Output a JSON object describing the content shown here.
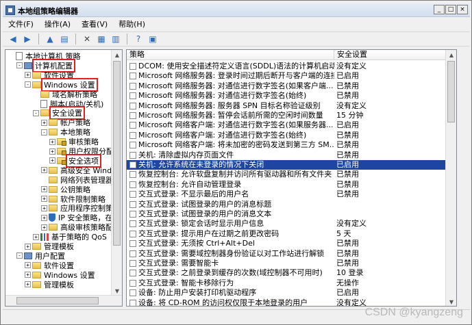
{
  "window": {
    "title": "本地组策略编辑器",
    "buttons": [
      "_",
      "□",
      "×"
    ]
  },
  "menu": [
    "文件(F)",
    "操作(A)",
    "查看(V)",
    "帮助(H)"
  ],
  "tree": [
    {
      "label": "本地计算机 策略",
      "depth": 0,
      "pm": "",
      "icon": "doc-icon",
      "hl": false
    },
    {
      "label": "计算机配置",
      "depth": 1,
      "pm": "-",
      "icon": "computer-icon",
      "hl": true
    },
    {
      "label": "软件设置",
      "depth": 2,
      "pm": "+",
      "icon": "folder-icon",
      "hl": false
    },
    {
      "label": "Windows 设置",
      "depth": 2,
      "pm": "-",
      "icon": "folder-icon",
      "hl": true
    },
    {
      "label": "域名解析策略",
      "depth": 3,
      "pm": "",
      "icon": "folder-icon",
      "hl": false
    },
    {
      "label": "脚本(启动/关机)",
      "depth": 3,
      "pm": "",
      "icon": "doc-icon",
      "hl": false
    },
    {
      "label": "安全设置",
      "depth": 3,
      "pm": "-",
      "icon": "folder-icon",
      "hl": true
    },
    {
      "label": "帐户策略",
      "depth": 4,
      "pm": "+",
      "icon": "folder-icon",
      "hl": false
    },
    {
      "label": "本地策略",
      "depth": 4,
      "pm": "-",
      "icon": "folder-icon",
      "hl": false
    },
    {
      "label": "审核策略",
      "depth": 5,
      "pm": "+",
      "icon": "folder-lock-icon",
      "hl": false
    },
    {
      "label": "用户权限分配",
      "depth": 5,
      "pm": "+",
      "icon": "folder-lock-icon",
      "hl": false
    },
    {
      "label": "安全选项",
      "depth": 5,
      "pm": "+",
      "icon": "folder-lock-icon",
      "hl": true
    },
    {
      "label": "高级安全 Window",
      "depth": 4,
      "pm": "+",
      "icon": "folder-icon",
      "hl": false
    },
    {
      "label": "网络列表管理器策",
      "depth": 4,
      "pm": "",
      "icon": "folder-icon",
      "hl": false
    },
    {
      "label": "公钥策略",
      "depth": 4,
      "pm": "+",
      "icon": "folder-icon",
      "hl": false
    },
    {
      "label": "软件限制策略",
      "depth": 4,
      "pm": "+",
      "icon": "folder-icon",
      "hl": false
    },
    {
      "label": "应用程序控制策略",
      "depth": 4,
      "pm": "+",
      "icon": "folder-icon",
      "hl": false
    },
    {
      "label": "IP 安全策略，在",
      "depth": 4,
      "pm": "+",
      "icon": "shield-icon",
      "hl": false
    },
    {
      "label": "高级审核策略配置",
      "depth": 4,
      "pm": "+",
      "icon": "folder-icon",
      "hl": false
    },
    {
      "label": "基于策略的 QoS",
      "depth": 3,
      "pm": "+",
      "icon": "chart-icon",
      "hl": false
    },
    {
      "label": "管理模板",
      "depth": 2,
      "pm": "+",
      "icon": "folder-icon",
      "hl": false
    },
    {
      "label": "用户配置",
      "depth": 1,
      "pm": "-",
      "icon": "computer-icon",
      "hl": false
    },
    {
      "label": "软件设置",
      "depth": 2,
      "pm": "+",
      "icon": "folder-icon",
      "hl": false
    },
    {
      "label": "Windows 设置",
      "depth": 2,
      "pm": "+",
      "icon": "folder-icon",
      "hl": false
    },
    {
      "label": "管理模板",
      "depth": 2,
      "pm": "+",
      "icon": "folder-icon",
      "hl": false
    }
  ],
  "columns": {
    "policy": "策略",
    "setting": "安全设置"
  },
  "policies": [
    {
      "name": "DCOM: 使用安全描述符定义语言(SDDL)语法的计算机启动限制",
      "setting": "没有定义"
    },
    {
      "name": "Microsoft 网络服务器: 登录时间过期后断开与客户端的连接",
      "setting": "已启用"
    },
    {
      "name": "Microsoft 网络服务器: 对通信进行数字签名(如果客户端...",
      "setting": "已禁用"
    },
    {
      "name": "Microsoft 网络服务器: 对通信进行数字签名(始终)",
      "setting": "已禁用"
    },
    {
      "name": "Microsoft 网络服务器: 服务器 SPN 目标名称验证级别",
      "setting": "没有定义"
    },
    {
      "name": "Microsoft 网络服务器: 暂停会话前所需的空闲时间数量",
      "setting": "15 分钟"
    },
    {
      "name": "Microsoft 网络客户端: 对通信进行数字签名(如果服务器...",
      "setting": "已启用"
    },
    {
      "name": "Microsoft 网络客户端: 对通信进行数字签名(始终)",
      "setting": "已禁用"
    },
    {
      "name": "Microsoft 网络客户端: 将未加密的密码发送到第三方 SM...",
      "setting": "已禁用"
    },
    {
      "name": "关机: 清除虚拟内存页面文件",
      "setting": "已禁用"
    },
    {
      "name": "关机: 允许系统在未登录的情况下关闭",
      "setting": "已启用"
    },
    {
      "name": "恢复控制台: 允许软盘复制并访问所有驱动器和所有文件夹",
      "setting": "已禁用"
    },
    {
      "name": "恢复控制台: 允许自动管理登录",
      "setting": "已禁用"
    },
    {
      "name": "交互式登录: 不显示最后的用户名",
      "setting": "已禁用"
    },
    {
      "name": "交互式登录: 试图登录的用户的消息标题",
      "setting": ""
    },
    {
      "name": "交互式登录: 试图登录的用户的消息文本",
      "setting": ""
    },
    {
      "name": "交互式登录: 锁定会话时显示用户信息",
      "setting": "没有定义"
    },
    {
      "name": "交互式登录: 提示用户在过期之前更改密码",
      "setting": "5 天"
    },
    {
      "name": "交互式登录: 无须按 Ctrl+Alt+Del",
      "setting": "已禁用"
    },
    {
      "name": "交互式登录: 需要域控制器身份验证以对工作站进行解锁",
      "setting": "已禁用"
    },
    {
      "name": "交互式登录: 需要智能卡",
      "setting": "已禁用"
    },
    {
      "name": "交互式登录: 之前登录到缓存的次数(域控制器不可用时)",
      "setting": "10 登录"
    },
    {
      "name": "交互式登录: 智能卡移除行为",
      "setting": "无操作"
    },
    {
      "name": "设备: 防止用户安装打印机驱动程序",
      "setting": "已启用"
    },
    {
      "name": "设备: 将 CD-ROM 的访问权仅限于本地登录的用户",
      "setting": "没有定义"
    }
  ],
  "selected_index": 10,
  "watermark": "CSDN @kyangzeng"
}
